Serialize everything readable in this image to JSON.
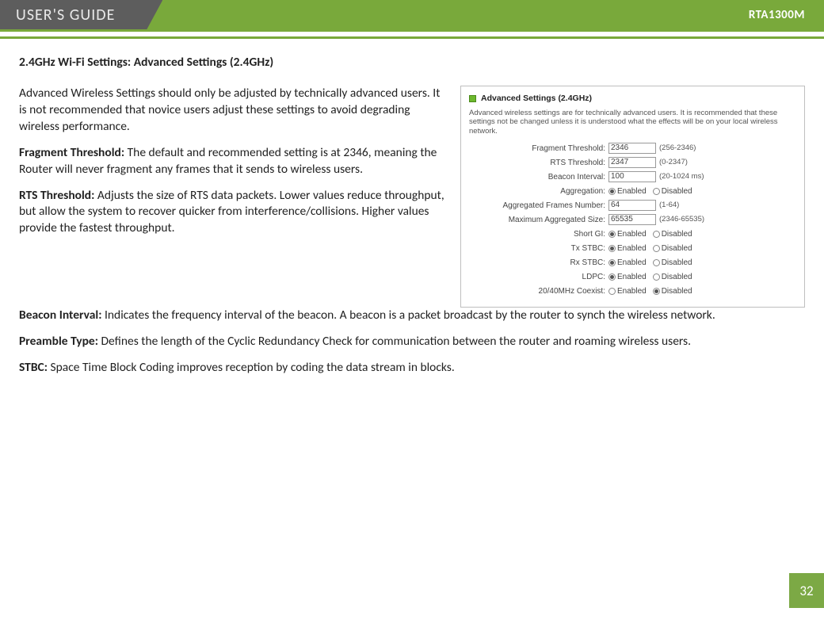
{
  "header": {
    "left": "USER'S GUIDE",
    "right": "RTA1300M"
  },
  "title": "2.4GHz Wi-Fi Settings: Advanced Settings (2.4GHz)",
  "intro": "Advanced Wireless Settings should only be adjusted by technically advanced users. It is not recommended that novice users adjust these settings to avoid degrading wireless performance.",
  "definitions": [
    {
      "term": "Fragment Threshold:",
      "text": " The default and recommended setting is at 2346, meaning the Router will never fragment any frames that it sends to wireless users."
    },
    {
      "term": "RTS Threshold:",
      "text": " Adjusts the size of RTS data packets. Lower values reduce throughput, but allow the system to recover quicker from interference/collisions. Higher values provide the fastest throughput."
    },
    {
      "term": "Beacon Interval:",
      "text": " Indicates the frequency interval of the beacon. A beacon is a packet broadcast by the router to synch the wireless network."
    },
    {
      "term": "Preamble Type:",
      "text": " Defines the length of the Cyclic Redundancy Check for communication between the router and roaming wireless users."
    },
    {
      "term": "STBC:",
      "text": " Space Time Block Coding improves reception by coding the data stream in blocks."
    }
  ],
  "panel": {
    "title": "Advanced Settings (2.4GHz)",
    "desc": "Advanced wireless settings are for technically advanced users. It is recommended that these settings not be changed unless it is understood what the effects will be on your local wireless network.",
    "rows": {
      "frag_label": "Fragment Threshold:",
      "frag_value": "2346",
      "frag_hint": "(256-2346)",
      "rts_label": "RTS Threshold:",
      "rts_value": "2347",
      "rts_hint": "(0-2347)",
      "beacon_label": "Beacon Interval:",
      "beacon_value": "100",
      "beacon_hint": "(20-1024 ms)",
      "agg_label": "Aggregation:",
      "afn_label": "Aggregated Frames Number:",
      "afn_value": "64",
      "afn_hint": "(1-64)",
      "mas_label": "Maximum Aggregated Size:",
      "mas_value": "65535",
      "mas_hint": "(2346-65535)",
      "sgi_label": "Short GI:",
      "txstbc_label": "Tx STBC:",
      "rxstbc_label": "Rx STBC:",
      "ldpc_label": "LDPC:",
      "coexist_label": "20/40MHz Coexist:"
    },
    "radio": {
      "enabled": "Enabled",
      "disabled": "Disabled"
    }
  },
  "page_number": "32"
}
